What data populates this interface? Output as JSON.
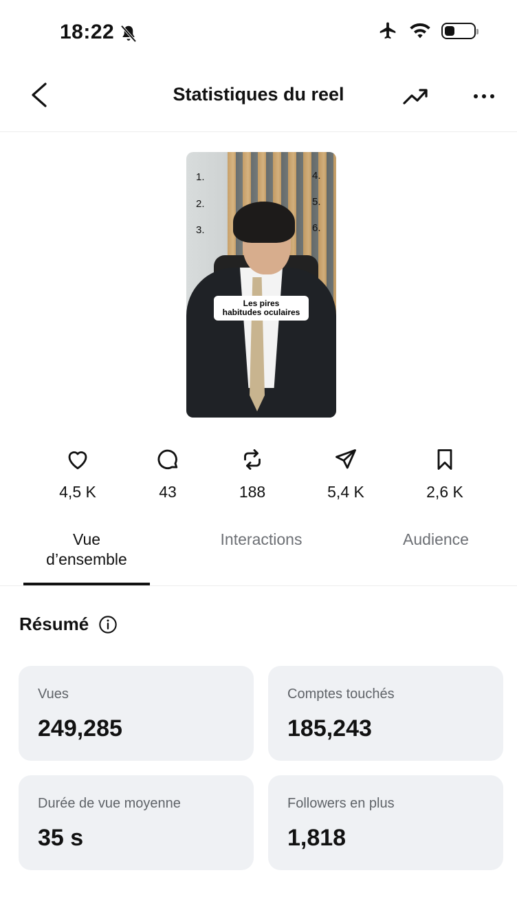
{
  "status_bar": {
    "time": "18:22",
    "icons": [
      "bell-muted-icon",
      "airplane-icon",
      "wifi-icon",
      "battery-icon"
    ]
  },
  "header": {
    "title": "Statistiques du reel",
    "back_icon": "chevron-left-icon",
    "trend_icon": "trending-up-icon",
    "more_icon": "more-horizontal-icon"
  },
  "thumbnail": {
    "caption_line1": "Les pires",
    "caption_line2": "habitudes oculaires",
    "numbers_left": [
      "1.",
      "2.",
      "3."
    ],
    "numbers_right": [
      "4.",
      "5.",
      "6."
    ]
  },
  "metrics": [
    {
      "icon": "heart-icon",
      "value": "4,5 K"
    },
    {
      "icon": "comment-icon",
      "value": "43"
    },
    {
      "icon": "repost-icon",
      "value": "188"
    },
    {
      "icon": "share-icon",
      "value": "5,4 K"
    },
    {
      "icon": "bookmark-icon",
      "value": "2,6 K"
    }
  ],
  "tabs": [
    {
      "line1": "Vue",
      "line2": "d’ensemble",
      "active": true
    },
    {
      "line1": "Interactions",
      "line2": "",
      "active": false
    },
    {
      "line1": "Audience",
      "line2": "",
      "active": false
    }
  ],
  "summary": {
    "title": "Résumé",
    "info_icon": "info-icon",
    "cards": [
      {
        "label": "Vues",
        "value": "249,285"
      },
      {
        "label": "Comptes touchés",
        "value": "185,243"
      },
      {
        "label": "Durée de vue moyenne",
        "value": "35 s"
      },
      {
        "label": "Followers en plus",
        "value": "1,818"
      }
    ]
  }
}
